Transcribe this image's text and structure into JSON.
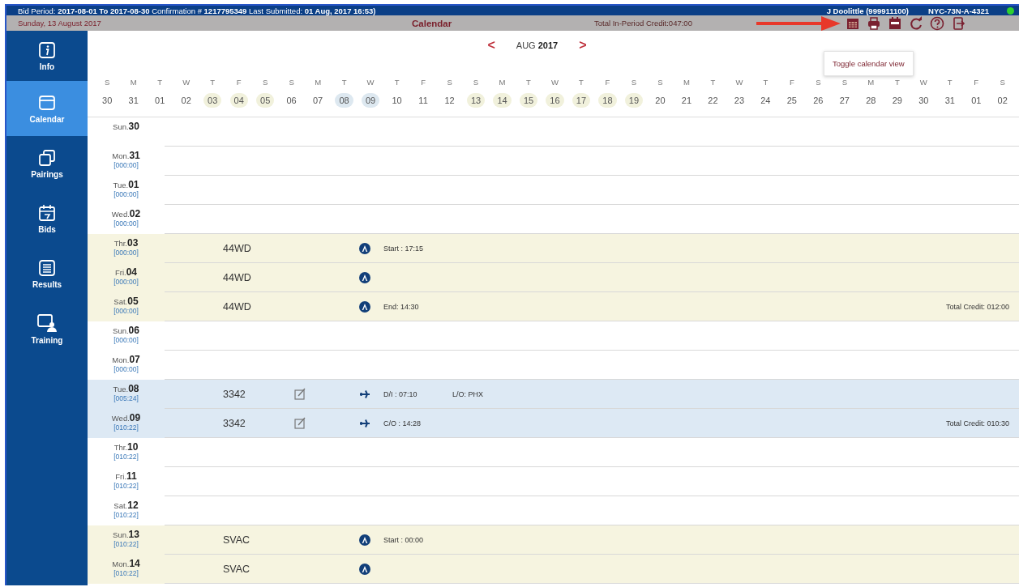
{
  "top_bar": {
    "info": "Bid Period: **2017-08-01 To 2017-08-30** Confirmation # **1217795349** Last Submitted: **01 Aug, 2017 16:53)**",
    "user": "J Doolittle (999911100)",
    "base": "NYC-73N-A-4321",
    "online": true
  },
  "sub_bar": {
    "date": "Sunday, 13 August 2017",
    "title": "Calendar",
    "credit": "Total In-Period Credit:047:00"
  },
  "tooltip": "Toggle calendar view",
  "sidebar": {
    "items": [
      {
        "label": "Info",
        "selected": false
      },
      {
        "label": "Calendar",
        "selected": true
      },
      {
        "label": "Pairings",
        "selected": false
      },
      {
        "label": "Bids",
        "selected": false
      },
      {
        "label": "Results",
        "selected": false
      },
      {
        "label": "Training",
        "selected": false
      }
    ]
  },
  "month_nav": {
    "prev": "<",
    "month": "AUG",
    "year": "2017",
    "next": ">"
  },
  "date_strip": [
    {
      "weekday": "S",
      "day": "30",
      "kind": "plain"
    },
    {
      "weekday": "M",
      "day": "31",
      "kind": "plain"
    },
    {
      "weekday": "T",
      "day": "01",
      "kind": "plain"
    },
    {
      "weekday": "W",
      "day": "02",
      "kind": "plain"
    },
    {
      "weekday": "T",
      "day": "03",
      "kind": "duty"
    },
    {
      "weekday": "F",
      "day": "04",
      "kind": "duty"
    },
    {
      "weekday": "S",
      "day": "05",
      "kind": "duty"
    },
    {
      "weekday": "S",
      "day": "06",
      "kind": "plain"
    },
    {
      "weekday": "M",
      "day": "07",
      "kind": "plain"
    },
    {
      "weekday": "T",
      "day": "08",
      "kind": "flight"
    },
    {
      "weekday": "W",
      "day": "09",
      "kind": "flight"
    },
    {
      "weekday": "T",
      "day": "10",
      "kind": "plain"
    },
    {
      "weekday": "F",
      "day": "11",
      "kind": "plain"
    },
    {
      "weekday": "S",
      "day": "12",
      "kind": "plain"
    },
    {
      "weekday": "S",
      "day": "13",
      "kind": "duty"
    },
    {
      "weekday": "M",
      "day": "14",
      "kind": "duty"
    },
    {
      "weekday": "T",
      "day": "15",
      "kind": "duty"
    },
    {
      "weekday": "W",
      "day": "16",
      "kind": "duty"
    },
    {
      "weekday": "T",
      "day": "17",
      "kind": "duty"
    },
    {
      "weekday": "F",
      "day": "18",
      "kind": "duty"
    },
    {
      "weekday": "S",
      "day": "19",
      "kind": "duty"
    },
    {
      "weekday": "S",
      "day": "20",
      "kind": "plain"
    },
    {
      "weekday": "M",
      "day": "21",
      "kind": "plain"
    },
    {
      "weekday": "T",
      "day": "22",
      "kind": "plain"
    },
    {
      "weekday": "W",
      "day": "23",
      "kind": "plain"
    },
    {
      "weekday": "T",
      "day": "24",
      "kind": "plain"
    },
    {
      "weekday": "F",
      "day": "25",
      "kind": "plain"
    },
    {
      "weekday": "S",
      "day": "26",
      "kind": "plain"
    },
    {
      "weekday": "S",
      "day": "27",
      "kind": "plain"
    },
    {
      "weekday": "M",
      "day": "28",
      "kind": "plain"
    },
    {
      "weekday": "T",
      "day": "29",
      "kind": "plain"
    },
    {
      "weekday": "W",
      "day": "30",
      "kind": "plain"
    },
    {
      "weekday": "T",
      "day": "31",
      "kind": "plain"
    },
    {
      "weekday": "F",
      "day": "01",
      "kind": "plain"
    },
    {
      "weekday": "S",
      "day": "02",
      "kind": "plain"
    }
  ],
  "days": [
    {
      "label": "Sun.**30**",
      "kind": "empty",
      "editable": false
    },
    {
      "label": "Mon.**31**",
      "credit": "[000:00]",
      "kind": "empty",
      "editable": false
    },
    {
      "label": "Tue.**01**",
      "credit": "[000:00]",
      "kind": "empty",
      "editable": false
    },
    {
      "label": "Wed.**02**",
      "credit": "[000:00]",
      "kind": "empty",
      "editable": false
    },
    {
      "label": "Thr.**03**",
      "credit": "[000:00]",
      "kind": "duty",
      "editable": false,
      "code": "44WD",
      "detail": "Start : 17:15"
    },
    {
      "label": "Fri.**04**",
      "credit": "[000:00]",
      "kind": "duty",
      "editable": false,
      "code": "44WD"
    },
    {
      "label": "Sat.**05**",
      "credit": "[000:00]",
      "kind": "duty",
      "editable": false,
      "code": "44WD",
      "detail": "End: 14:30",
      "total": "Total Credit: 012:00"
    },
    {
      "label": "Sun.**06**",
      "credit": "[000:00]",
      "kind": "empty",
      "editable": false
    },
    {
      "label": "Mon.**07**",
      "credit": "[000:00]",
      "kind": "empty",
      "editable": false
    },
    {
      "label": "Tue.**08**",
      "credit": "[005:24]",
      "kind": "flight",
      "editable": true,
      "code": "3342",
      "detail": "D/I : 07:10",
      "extra": "L/O: PHX"
    },
    {
      "label": "Wed.**09**",
      "credit": "[010:22]",
      "kind": "flight",
      "editable": true,
      "code": "3342",
      "detail": "C/O : 14:28",
      "total": "Total Credit: 010:30"
    },
    {
      "label": "Thr.**10**",
      "credit": "[010:22]",
      "kind": "empty",
      "editable": false
    },
    {
      "label": "Fri.**11**",
      "credit": "[010:22]",
      "kind": "empty",
      "editable": false
    },
    {
      "label": "Sat.**12**",
      "credit": "[010:22]",
      "kind": "empty",
      "editable": false
    },
    {
      "label": "Sun.**13**",
      "credit": "[010:22]",
      "kind": "duty",
      "editable": false,
      "code": "SVAC",
      "detail": "Start : 00:00"
    },
    {
      "label": "Mon.**14**",
      "credit": "[010:22]",
      "kind": "duty",
      "editable": false,
      "code": "SVAC"
    }
  ]
}
